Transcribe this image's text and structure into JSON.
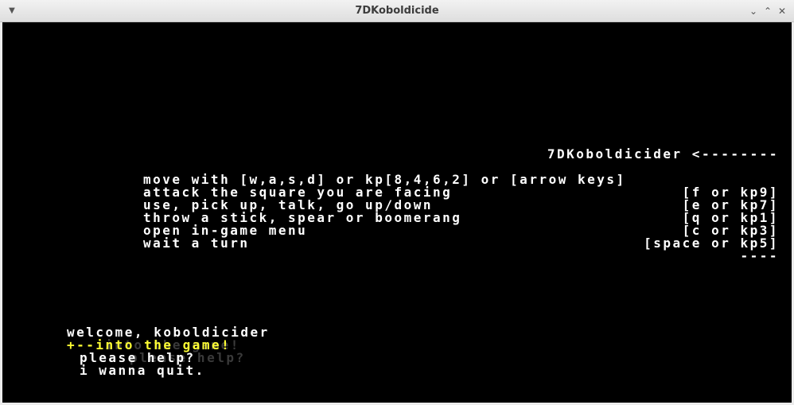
{
  "window": {
    "title": "7DKoboldicide"
  },
  "help": {
    "heading": "7DKoboldicider <--------",
    "rows": [
      {
        "action": "move with [w,a,s,d] or kp[8,4,6,2] or [arrow keys]",
        "key": ""
      },
      {
        "action": "attack the square you are facing",
        "key": "[f or kp9]"
      },
      {
        "action": "use, pick up, talk, go up/down",
        "key": "[e or kp7]"
      },
      {
        "action": "throw a stick, spear or boomerang",
        "key": "[q or kp1]"
      },
      {
        "action": "open in-game menu",
        "key": "[c or kp3]"
      },
      {
        "action": "wait a turn",
        "key": "[space or kp5]"
      }
    ],
    "footer": "----"
  },
  "menu": {
    "greeting": "welcome, koboldicider",
    "selected_prefix": "+--",
    "items": [
      "into the game!",
      "please help?",
      "i wanna quit."
    ],
    "ghost_text": "into the game!",
    "ghost_help": "please help?"
  },
  "colors": {
    "text": "#ffffff",
    "selected": "#ffff33",
    "background": "#000000"
  }
}
